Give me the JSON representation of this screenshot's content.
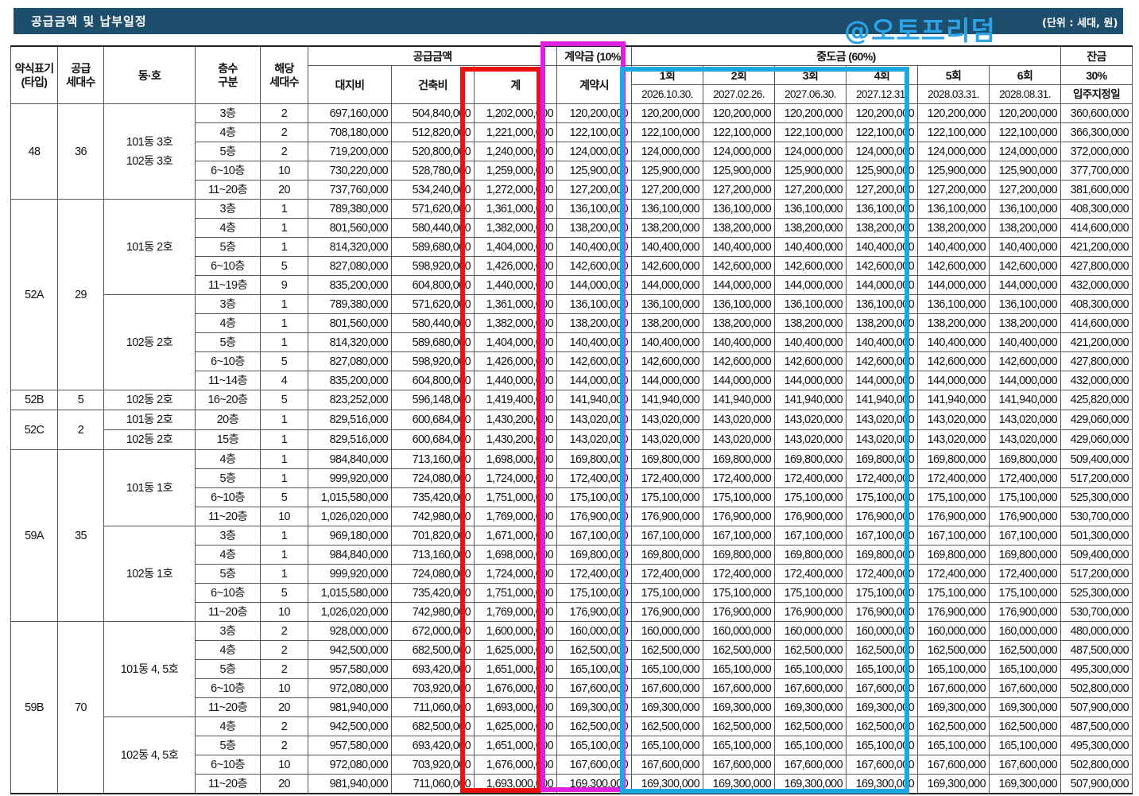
{
  "title": "공급금액 및 납부일정",
  "watermark": "@오토프리덤",
  "unit": "(단위 : 세대, 원)",
  "headers": {
    "type": "약식표기\n(타입)",
    "supply_count": "공급\n세대수",
    "dong_ho": "동·호",
    "floor": "층수\n구분",
    "units": "해당\n세대수",
    "supply_price": "공급금액",
    "land": "대지비",
    "building": "건축비",
    "total": "계",
    "deposit": "계약금 (10%)",
    "deposit_sub": "계약시",
    "interim": "중도금 (60%)",
    "balance": "잔금",
    "balance_pct": "30%",
    "balance_date": "입주지정일",
    "installments": [
      {
        "label": "1회",
        "date": "2026.10.30."
      },
      {
        "label": "2회",
        "date": "2027.02.26."
      },
      {
        "label": "3회",
        "date": "2027.06.30."
      },
      {
        "label": "4회",
        "date": "2027.12.31."
      },
      {
        "label": "5회",
        "date": "2028.03.31."
      },
      {
        "label": "6회",
        "date": "2028.08.31."
      }
    ]
  },
  "groups": [
    {
      "type": "48",
      "count": "36",
      "dongs": [
        {
          "dong": "101동 3호\n102동 3호",
          "rows": [
            {
              "floor": "3층",
              "units": "2",
              "land": "697,160,000",
              "bldg": "504,840,000",
              "total": "1,202,000,000",
              "dep": "120,200,000",
              "mid": "120,200,000",
              "bal": "360,600,000"
            },
            {
              "floor": "4층",
              "units": "2",
              "land": "708,180,000",
              "bldg": "512,820,000",
              "total": "1,221,000,000",
              "dep": "122,100,000",
              "mid": "122,100,000",
              "bal": "366,300,000"
            },
            {
              "floor": "5층",
              "units": "2",
              "land": "719,200,000",
              "bldg": "520,800,000",
              "total": "1,240,000,000",
              "dep": "124,000,000",
              "mid": "124,000,000",
              "bal": "372,000,000"
            },
            {
              "floor": "6~10층",
              "units": "10",
              "land": "730,220,000",
              "bldg": "528,780,000",
              "total": "1,259,000,000",
              "dep": "125,900,000",
              "mid": "125,900,000",
              "bal": "377,700,000"
            },
            {
              "floor": "11~20층",
              "units": "20",
              "land": "737,760,000",
              "bldg": "534,240,000",
              "total": "1,272,000,000",
              "dep": "127,200,000",
              "mid": "127,200,000",
              "bal": "381,600,000"
            }
          ]
        }
      ]
    },
    {
      "type": "52A",
      "count": "29",
      "dongs": [
        {
          "dong": "101동 2호",
          "rows": [
            {
              "floor": "3층",
              "units": "1",
              "land": "789,380,000",
              "bldg": "571,620,000",
              "total": "1,361,000,000",
              "dep": "136,100,000",
              "mid": "136,100,000",
              "bal": "408,300,000"
            },
            {
              "floor": "4층",
              "units": "1",
              "land": "801,560,000",
              "bldg": "580,440,000",
              "total": "1,382,000,000",
              "dep": "138,200,000",
              "mid": "138,200,000",
              "bal": "414,600,000"
            },
            {
              "floor": "5층",
              "units": "1",
              "land": "814,320,000",
              "bldg": "589,680,000",
              "total": "1,404,000,000",
              "dep": "140,400,000",
              "mid": "140,400,000",
              "bal": "421,200,000"
            },
            {
              "floor": "6~10층",
              "units": "5",
              "land": "827,080,000",
              "bldg": "598,920,000",
              "total": "1,426,000,000",
              "dep": "142,600,000",
              "mid": "142,600,000",
              "bal": "427,800,000"
            },
            {
              "floor": "11~19층",
              "units": "9",
              "land": "835,200,000",
              "bldg": "604,800,000",
              "total": "1,440,000,000",
              "dep": "144,000,000",
              "mid": "144,000,000",
              "bal": "432,000,000"
            }
          ]
        },
        {
          "dong": "102동 2호",
          "rows": [
            {
              "floor": "3층",
              "units": "1",
              "land": "789,380,000",
              "bldg": "571,620,000",
              "total": "1,361,000,000",
              "dep": "136,100,000",
              "mid": "136,100,000",
              "bal": "408,300,000"
            },
            {
              "floor": "4층",
              "units": "1",
              "land": "801,560,000",
              "bldg": "580,440,000",
              "total": "1,382,000,000",
              "dep": "138,200,000",
              "mid": "138,200,000",
              "bal": "414,600,000"
            },
            {
              "floor": "5층",
              "units": "1",
              "land": "814,320,000",
              "bldg": "589,680,000",
              "total": "1,404,000,000",
              "dep": "140,400,000",
              "mid": "140,400,000",
              "bal": "421,200,000"
            },
            {
              "floor": "6~10층",
              "units": "5",
              "land": "827,080,000",
              "bldg": "598,920,000",
              "total": "1,426,000,000",
              "dep": "142,600,000",
              "mid": "142,600,000",
              "bal": "427,800,000"
            },
            {
              "floor": "11~14층",
              "units": "4",
              "land": "835,200,000",
              "bldg": "604,800,000",
              "total": "1,440,000,000",
              "dep": "144,000,000",
              "mid": "144,000,000",
              "bal": "432,000,000"
            }
          ]
        }
      ]
    },
    {
      "type": "52B",
      "count": "5",
      "dongs": [
        {
          "dong": "102동 2호",
          "rows": [
            {
              "floor": "16~20층",
              "units": "5",
              "land": "823,252,000",
              "bldg": "596,148,000",
              "total": "1,419,400,000",
              "dep": "141,940,000",
              "mid": "141,940,000",
              "bal": "425,820,000"
            }
          ]
        }
      ]
    },
    {
      "type": "52C",
      "count": "2",
      "dongs": [
        {
          "dong": "101동 2호",
          "rows": [
            {
              "floor": "20층",
              "units": "1",
              "land": "829,516,000",
              "bldg": "600,684,000",
              "total": "1,430,200,000",
              "dep": "143,020,000",
              "mid": "143,020,000",
              "bal": "429,060,000"
            }
          ]
        },
        {
          "dong": "102동 2호",
          "rows": [
            {
              "floor": "15층",
              "units": "1",
              "land": "829,516,000",
              "bldg": "600,684,000",
              "total": "1,430,200,000",
              "dep": "143,020,000",
              "mid": "143,020,000",
              "bal": "429,060,000"
            }
          ]
        }
      ]
    },
    {
      "type": "59A",
      "count": "35",
      "dongs": [
        {
          "dong": "101동 1호",
          "rows": [
            {
              "floor": "4층",
              "units": "1",
              "land": "984,840,000",
              "bldg": "713,160,000",
              "total": "1,698,000,000",
              "dep": "169,800,000",
              "mid": "169,800,000",
              "bal": "509,400,000"
            },
            {
              "floor": "5층",
              "units": "1",
              "land": "999,920,000",
              "bldg": "724,080,000",
              "total": "1,724,000,000",
              "dep": "172,400,000",
              "mid": "172,400,000",
              "bal": "517,200,000"
            },
            {
              "floor": "6~10층",
              "units": "5",
              "land": "1,015,580,000",
              "bldg": "735,420,000",
              "total": "1,751,000,000",
              "dep": "175,100,000",
              "mid": "175,100,000",
              "bal": "525,300,000"
            },
            {
              "floor": "11~20층",
              "units": "10",
              "land": "1,026,020,000",
              "bldg": "742,980,000",
              "total": "1,769,000,000",
              "dep": "176,900,000",
              "mid": "176,900,000",
              "bal": "530,700,000"
            }
          ]
        },
        {
          "dong": "102동 1호",
          "rows": [
            {
              "floor": "3층",
              "units": "1",
              "land": "969,180,000",
              "bldg": "701,820,000",
              "total": "1,671,000,000",
              "dep": "167,100,000",
              "mid": "167,100,000",
              "bal": "501,300,000"
            },
            {
              "floor": "4층",
              "units": "1",
              "land": "984,840,000",
              "bldg": "713,160,000",
              "total": "1,698,000,000",
              "dep": "169,800,000",
              "mid": "169,800,000",
              "bal": "509,400,000"
            },
            {
              "floor": "5층",
              "units": "1",
              "land": "999,920,000",
              "bldg": "724,080,000",
              "total": "1,724,000,000",
              "dep": "172,400,000",
              "mid": "172,400,000",
              "bal": "517,200,000"
            },
            {
              "floor": "6~10층",
              "units": "5",
              "land": "1,015,580,000",
              "bldg": "735,420,000",
              "total": "1,751,000,000",
              "dep": "175,100,000",
              "mid": "175,100,000",
              "bal": "525,300,000"
            },
            {
              "floor": "11~20층",
              "units": "10",
              "land": "1,026,020,000",
              "bldg": "742,980,000",
              "total": "1,769,000,000",
              "dep": "176,900,000",
              "mid": "176,900,000",
              "bal": "530,700,000"
            }
          ]
        }
      ]
    },
    {
      "type": "59B",
      "count": "70",
      "dongs": [
        {
          "dong": "101동 4, 5호",
          "rows": [
            {
              "floor": "3층",
              "units": "2",
              "land": "928,000,000",
              "bldg": "672,000,000",
              "total": "1,600,000,000",
              "dep": "160,000,000",
              "mid": "160,000,000",
              "bal": "480,000,000"
            },
            {
              "floor": "4층",
              "units": "2",
              "land": "942,500,000",
              "bldg": "682,500,000",
              "total": "1,625,000,000",
              "dep": "162,500,000",
              "mid": "162,500,000",
              "bal": "487,500,000"
            },
            {
              "floor": "5층",
              "units": "2",
              "land": "957,580,000",
              "bldg": "693,420,000",
              "total": "1,651,000,000",
              "dep": "165,100,000",
              "mid": "165,100,000",
              "bal": "495,300,000"
            },
            {
              "floor": "6~10층",
              "units": "10",
              "land": "972,080,000",
              "bldg": "703,920,000",
              "total": "1,676,000,000",
              "dep": "167,600,000",
              "mid": "167,600,000",
              "bal": "502,800,000"
            },
            {
              "floor": "11~20층",
              "units": "20",
              "land": "981,940,000",
              "bldg": "711,060,000",
              "total": "1,693,000,000",
              "dep": "169,300,000",
              "mid": "169,300,000",
              "bal": "507,900,000"
            }
          ]
        },
        {
          "dong": "102동 4, 5호",
          "rows": [
            {
              "floor": "4층",
              "units": "2",
              "land": "942,500,000",
              "bldg": "682,500,000",
              "total": "1,625,000,000",
              "dep": "162,500,000",
              "mid": "162,500,000",
              "bal": "487,500,000"
            },
            {
              "floor": "5층",
              "units": "2",
              "land": "957,580,000",
              "bldg": "693,420,000",
              "total": "1,651,000,000",
              "dep": "165,100,000",
              "mid": "165,100,000",
              "bal": "495,300,000"
            },
            {
              "floor": "6~10층",
              "units": "10",
              "land": "972,080,000",
              "bldg": "703,920,000",
              "total": "1,676,000,000",
              "dep": "167,600,000",
              "mid": "167,600,000",
              "bal": "502,800,000"
            },
            {
              "floor": "11~20층",
              "units": "20",
              "land": "981,940,000",
              "bldg": "711,060,000",
              "total": "1,693,000,000",
              "dep": "169,300,000",
              "mid": "169,300,000",
              "bal": "507,900,000"
            }
          ]
        }
      ]
    }
  ],
  "highlights": {
    "red": "#ee1111",
    "magenta": "#e11fe1",
    "blue": "#1da7e5"
  }
}
